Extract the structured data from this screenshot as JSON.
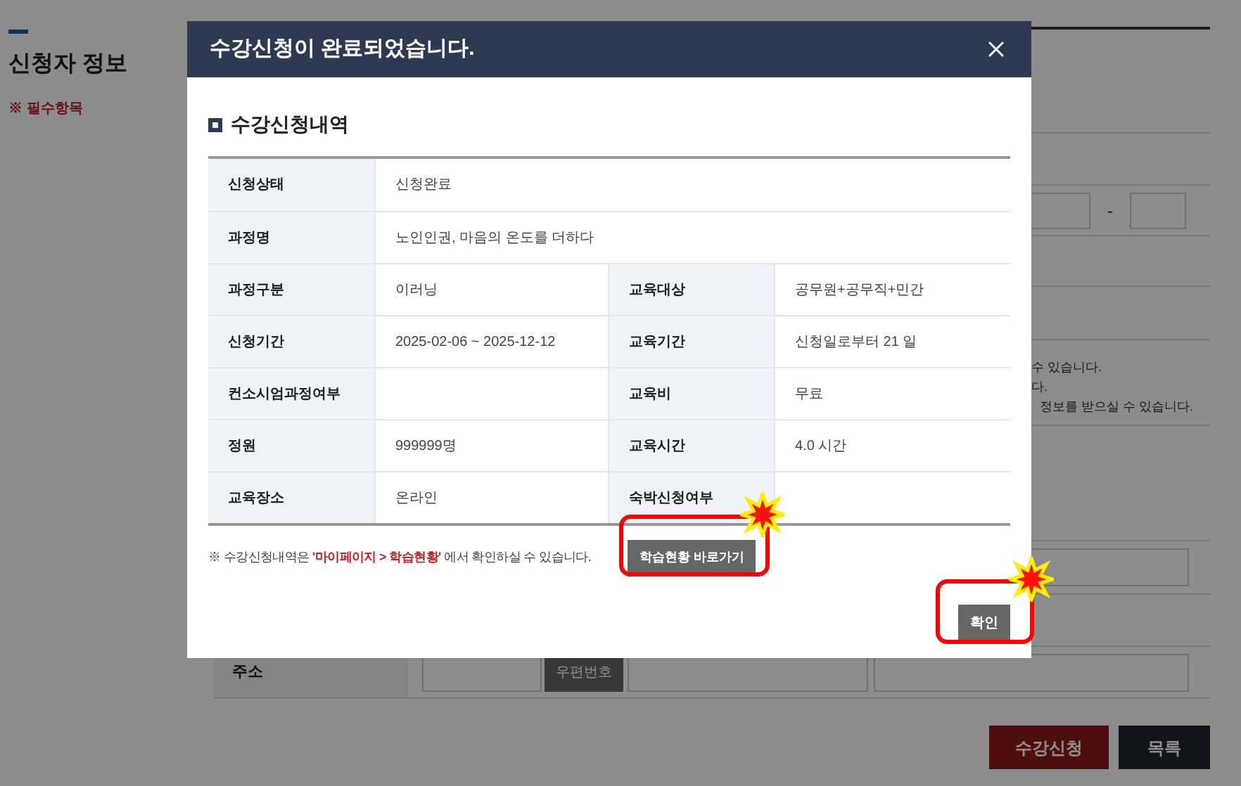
{
  "page": {
    "section_title": "신청자 정보",
    "required_note": "※ 필수항목",
    "phone_separator": "-",
    "notice_lines": [
      "수 있습니다.",
      "다.",
      "정보를 받으실 수 있습니다."
    ],
    "address_label": "주소",
    "zip_button": "우편번호",
    "buttons": [
      {
        "label": "수강신청",
        "kind": "primary"
      },
      {
        "label": "목록",
        "kind": "secondary"
      }
    ]
  },
  "modal": {
    "title": "수강신청이 완료되었습니다.",
    "section_title": "수강신청내역",
    "rows": [
      {
        "cells": [
          {
            "label": "신청상태",
            "value": "신청완료"
          }
        ]
      },
      {
        "cells": [
          {
            "label": "과정명",
            "value": "노인인권, 마음의 온도를 더하다"
          }
        ]
      },
      {
        "cells": [
          {
            "label": "과정구분",
            "value": "이러닝"
          },
          {
            "label": "교육대상",
            "value": "공무원+공무직+민간"
          }
        ]
      },
      {
        "cells": [
          {
            "label": "신청기간",
            "value": "2025-02-06 ~ 2025-12-12"
          },
          {
            "label": "교육기간",
            "value": "신청일로부터 21 일"
          }
        ]
      },
      {
        "cells": [
          {
            "label": "컨소시엄과정여부"
          },
          {
            "label": "교육비",
            "value": "무료"
          }
        ]
      },
      {
        "cells": [
          {
            "label": "정원",
            "value": "999999명"
          },
          {
            "label": "교육시간",
            "value": "4.0 시간"
          }
        ]
      },
      {
        "cells": [
          {
            "label": "교육장소",
            "value": "온라인"
          },
          {
            "label": "숙박신청여부"
          }
        ]
      }
    ],
    "note": {
      "prefix": "※ 수강신청내역은 ",
      "highlight": "'마이페이지 > 학습현황'",
      "suffix": " 에서 확인하실 수 있습니다."
    },
    "shortcut_button": "학습현황 바로가기",
    "confirm_button": "확인"
  }
}
